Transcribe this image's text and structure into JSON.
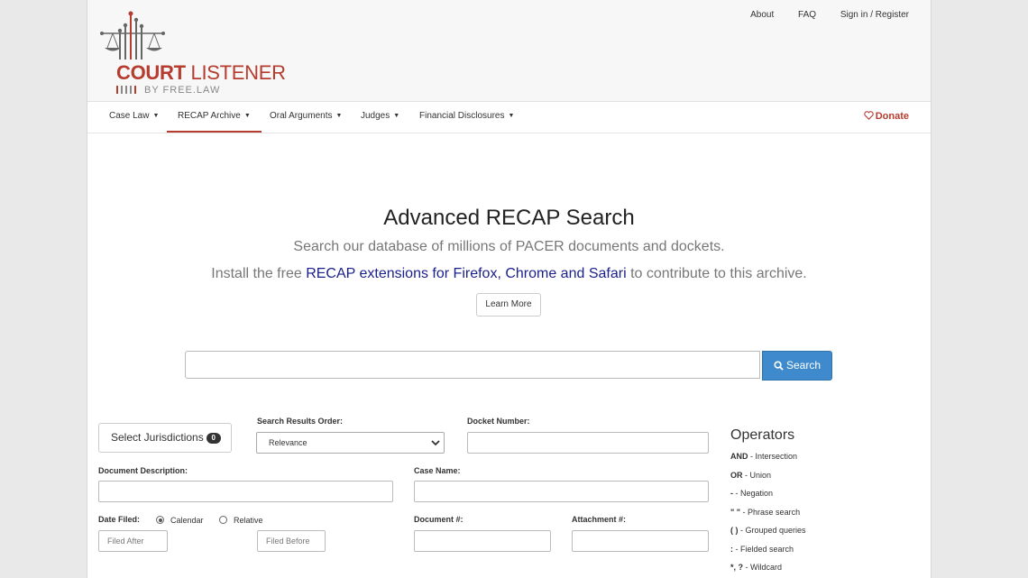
{
  "brand": {
    "name_part1": "COURT",
    "name_part2": "LISTENER",
    "subtitle": "BY FREE.LAW"
  },
  "top_links": [
    "About",
    "FAQ",
    "Sign in / Register"
  ],
  "nav": {
    "items": [
      "Case Law",
      "RECAP Archive",
      "Oral Arguments",
      "Judges",
      "Financial Disclosures"
    ],
    "active": "RECAP Archive",
    "donate": "Donate"
  },
  "hero": {
    "title": "Advanced RECAP Search",
    "subtitle": "Search our database of millions of PACER documents and dockets.",
    "install_prefix": "Install the free",
    "install_link": "RECAP extensions for Firefox, Chrome and Safari",
    "install_suffix": "to contribute to this archive.",
    "learn_more": "Learn More"
  },
  "search": {
    "value": "",
    "button": "Search"
  },
  "form": {
    "jurisdictions_label": "Select Jurisdictions",
    "jurisdictions_count": "0",
    "results_order_label": "Search Results Order:",
    "results_order_value": "Relevance",
    "docket_number_label": "Docket Number:",
    "document_description_label": "Document Description:",
    "case_name_label": "Case Name:",
    "date_filed_label": "Date Filed:",
    "date_mode_calendar": "Calendar",
    "date_mode_relative": "Relative",
    "date_mode_selected": "Calendar",
    "filed_after_placeholder": "Filed After",
    "filed_before_placeholder": "Filed Before",
    "document_number_label": "Document #:",
    "attachment_number_label": "Attachment #:"
  },
  "operators": {
    "title": "Operators",
    "items": [
      {
        "op": "AND",
        "desc": " - Intersection"
      },
      {
        "op": "OR",
        "desc": " - Union"
      },
      {
        "op": "-",
        "desc": " - Negation"
      },
      {
        "op": "\" \"",
        "desc": " - Phrase search"
      },
      {
        "op": "( )",
        "desc": " - Grouped queries"
      },
      {
        "op": ":",
        "desc": " - Fielded search"
      },
      {
        "op": "*, ?",
        "desc": " - Wildcard"
      }
    ]
  },
  "colors": {
    "brand_red": "#b53c2f",
    "link_blue": "#1a1f8a",
    "button_blue": "#3e8acc"
  }
}
